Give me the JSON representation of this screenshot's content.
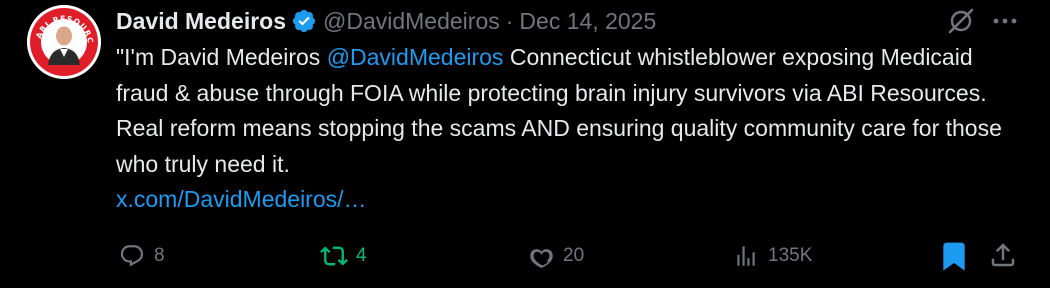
{
  "author": {
    "name": "David Medeiros",
    "handle": "@DavidMedeiros",
    "separator": "·",
    "date": "Dec 14, 2025",
    "avatar_ring_text": "ABI RESOURCES"
  },
  "tweet": {
    "text_prefix": "\"I'm David Medeiros ",
    "mention": "@DavidMedeiros",
    "text_main": " Connecticut whistleblower exposing Medicaid fraud & abuse through FOIA while protecting brain injury survivors via ABI Resources. Real reform means stopping the scams AND ensuring quality community care for those who truly need it.",
    "url": "x.com/DavidMedeiros/…"
  },
  "actions": {
    "replies": "8",
    "reposts": "4",
    "likes": "20",
    "views": "135K"
  },
  "icons": {
    "verified": "verified-badge-icon",
    "grok": "grok-icon",
    "more": "more-icon",
    "reply": "reply-icon",
    "repost": "repost-icon",
    "like": "heart-icon",
    "views": "views-icon",
    "bookmark": "bookmark-icon",
    "share": "share-icon"
  },
  "colors": {
    "background": "#000000",
    "text": "#e7e9ea",
    "muted": "#71767b",
    "link": "#1d9bf0",
    "repost_active": "#00ba7c",
    "bookmark_active": "#1d9bf0"
  }
}
